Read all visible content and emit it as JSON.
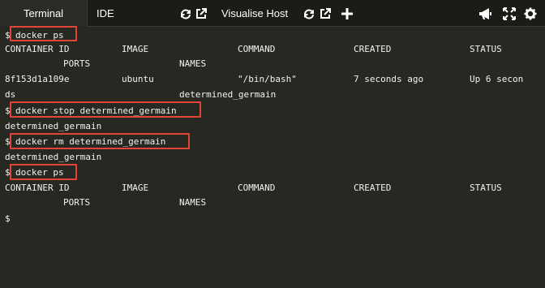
{
  "tabs": {
    "terminal": "Terminal",
    "ide": "IDE",
    "visualise_host": "Visualise Host"
  },
  "icons": {
    "refresh": "refresh-icon",
    "external": "external-link-icon",
    "add": "plus-icon",
    "announce": "megaphone-icon",
    "fullscreen": "expand-icon",
    "settings": "gear-icon"
  },
  "colors": {
    "terminal_bg": "#272822",
    "highlight_box": "#e0453a",
    "text": "#f2f2f2"
  },
  "terminal": {
    "prompt": "$",
    "cmd1": "docker ps",
    "headers": [
      "CONTAINER ID",
      "IMAGE",
      "COMMAND",
      "CREATED",
      "STATUS"
    ],
    "headers2": [
      "PORTS",
      "NAMES"
    ],
    "row": {
      "id": "8f153d1a109e",
      "image": "ubuntu",
      "command": "\"/bin/bash\"",
      "created": "7 seconds ago",
      "status": "Up 6 secon",
      "status_wrap": "ds",
      "name": "determined_germain"
    },
    "cmd2": "docker stop determined_germain",
    "out2": "determined_germain",
    "cmd3": "docker rm determined_germain",
    "out3": "determined_germain",
    "cmd4": "docker ps",
    "final_prompt": "$"
  }
}
